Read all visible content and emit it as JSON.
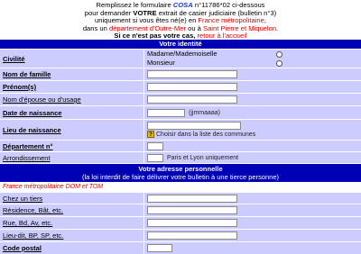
{
  "intro": {
    "line1a": "Remplissez le formulaire ",
    "cosa": "COSA",
    "line1b": " n°11786*02 ci-dessous",
    "line2a": "pour demander ",
    "votre": "VOTRE",
    "line2b": " extrait de casier judiciaire (bulletin n°3)",
    "line3a": "uniquement si vous êtes né(e) en ",
    "line3b": "France métropolitaine",
    "line3c": ",",
    "line4a": "dans un ",
    "line4b": "département d'Outre-Mer",
    "line4c": " ou à ",
    "line4d": "Saint Pierre et Miquelon",
    "line4e": ".",
    "line5": "Si ce n'est pas votre cas, ",
    "back_link": "retour à l'accueil"
  },
  "identity": {
    "header": "Votre identité",
    "civilite_label": "Civilité",
    "option1": "Madame/Mademoiselle",
    "option2": "Monsieur",
    "nom_label": "Nom de famille",
    "prenoms_label": "Prénom(s)",
    "epouse_label": "Nom d'épouse ou d'usage",
    "date_label": "Date de naissance",
    "date_hint": "(jjmmaaaa)",
    "lieu_label": "Lieu de naissance",
    "help_icon_text": "?",
    "lieu_hint": "Choisir dans la liste des communes",
    "dept_label": "Département n°",
    "arr_label": "Arrondissement",
    "arr_hint": "Paris et Lyon uniquement"
  },
  "address": {
    "header": "Votre adresse personnelle",
    "subheader": "(la loi interdit de faire délivrer votre bulletin à une tierce personne)",
    "region_note": "France métropolitaine DOM et TOM",
    "tiers_label": "Chez un tiers",
    "residence_label": "Résidence, Bât, etc.",
    "rue_label": "Rue, Bd, Av, etc.",
    "lieudit_label": "Lieu-dit, BP, SP, etc.",
    "cp_label": "Code postal"
  }
}
